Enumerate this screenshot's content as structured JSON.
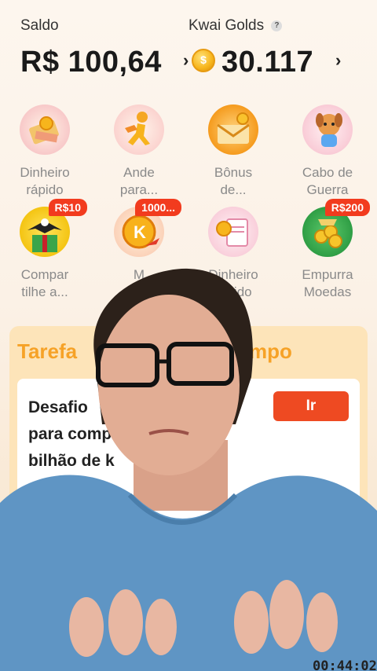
{
  "header": {
    "saldo_label": "Saldo",
    "saldo_value": "R$ 100,64",
    "golds_label": "Kwai Golds",
    "golds_help": "?",
    "golds_value": "30.117",
    "chevron": "›"
  },
  "shortcuts": [
    {
      "label_1": "Dinheiro",
      "label_2": "rápido",
      "icon": "money-envelope-icon",
      "badge": ""
    },
    {
      "label_1": "Ande",
      "label_2": "para...",
      "icon": "runner-icon",
      "badge": ""
    },
    {
      "label_1": "Bônus",
      "label_2": "de...",
      "icon": "bonus-envelope-icon",
      "badge": ""
    },
    {
      "label_1": "Cabo de",
      "label_2": "Guerra",
      "icon": "dog-mascot-icon",
      "badge": ""
    },
    {
      "label_1": "Compar",
      "label_2": "tilhe a...",
      "icon": "gift-eagle-icon",
      "badge": "R$10"
    },
    {
      "label_1": "M",
      "label_2": "",
      "icon": "gold-coin-k-icon",
      "badge": "1000..."
    },
    {
      "label_1": "Dinheiro",
      "label_2": "rápido",
      "icon": "receipt-coin-icon",
      "badge": ""
    },
    {
      "label_1": "Empurra",
      "label_2": "Moedas",
      "icon": "coin-pusher-icon",
      "badge": "R$200"
    }
  ],
  "task": {
    "title_left": "Tarefa",
    "title_right": "mpo",
    "text_1": "Desafio",
    "text_2": "para comp",
    "text_3": "bilhão de k",
    "go_label": "Ir",
    "timer": "00:44:02"
  },
  "colors": {
    "accent": "#ee4a22",
    "badge": "#f23b1e",
    "task_title": "#f6a227"
  }
}
